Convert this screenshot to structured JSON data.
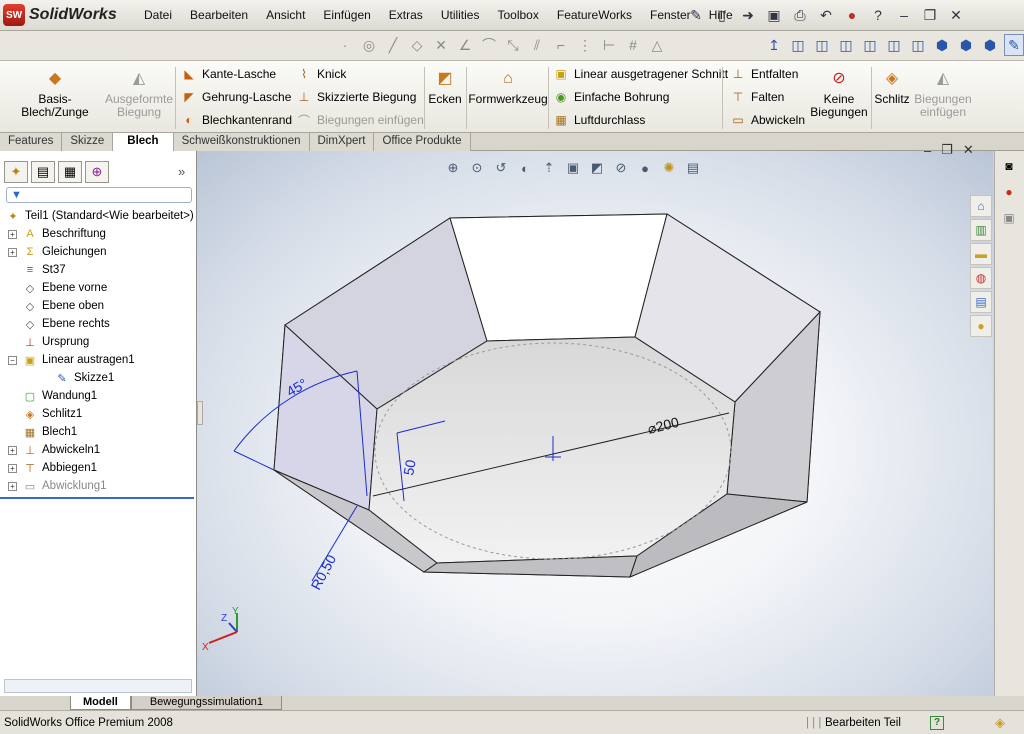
{
  "app": {
    "logo_mark": "SW",
    "logo_text": "SolidWorks"
  },
  "menu": [
    "Datei",
    "Bearbeiten",
    "Ansicht",
    "Einfügen",
    "Extras",
    "Utilities",
    "Toolbox",
    "FeatureWorks",
    "Fenster",
    "Hilfe"
  ],
  "commands": {
    "basis_blech": "Basis-Blech/Zunge",
    "ausgeformte_biegung": "Ausgeformte Biegung",
    "kante_lasche": "Kante-Lasche",
    "gehrung_lasche": "Gehrung-Lasche",
    "blechkantenrand": "Blechkantenrand",
    "knick": "Knick",
    "skizzierte_biegung": "Skizzierte Biegung",
    "biegungen_einfuegen_small": "Biegungen einfügen",
    "ecken": "Ecken",
    "formwerkzeug": "Formwerkzeug",
    "linear_schnitt": "Linear ausgetragener Schnitt",
    "einfache_bohrung": "Einfache Bohrung",
    "luftdurchlass": "Luftdurchlass",
    "entfalten": "Entfalten",
    "falten": "Falten",
    "abwickeln": "Abwickeln",
    "keine_biegungen": "Keine Biegungen",
    "schlitz": "Schlitz",
    "biegungen_einfuegen_big": "Biegungen einfügen"
  },
  "tabs": [
    "Features",
    "Skizze",
    "Blech",
    "Schweißkonstruktionen",
    "DimXpert",
    "Office Produkte"
  ],
  "active_tab": "Blech",
  "tree": {
    "root": "Teil1  (Standard<Wie bearbeitet>)",
    "items": [
      {
        "label": "Beschriftung",
        "icon": "annotation-icon",
        "expand": "+"
      },
      {
        "label": "Gleichungen",
        "icon": "equations-icon",
        "expand": "+"
      },
      {
        "label": "St37",
        "icon": "material-icon",
        "expand": ""
      },
      {
        "label": "Ebene vorne",
        "icon": "plane-icon",
        "expand": ""
      },
      {
        "label": "Ebene oben",
        "icon": "plane-icon",
        "expand": ""
      },
      {
        "label": "Ebene rechts",
        "icon": "plane-icon",
        "expand": ""
      },
      {
        "label": "Ursprung",
        "icon": "origin-icon",
        "expand": ""
      },
      {
        "label": "Linear austragen1",
        "icon": "extrude-icon",
        "expand": "−"
      },
      {
        "label": "Skizze1",
        "icon": "sketch-icon",
        "expand": "",
        "indent": true
      },
      {
        "label": "Wandung1",
        "icon": "shell-icon",
        "expand": ""
      },
      {
        "label": "Schlitz1",
        "icon": "rip-icon",
        "expand": ""
      },
      {
        "label": "Blech1",
        "icon": "sheetmetal-icon",
        "expand": ""
      },
      {
        "label": "Abwickeln1",
        "icon": "unfold-icon",
        "expand": "+"
      },
      {
        "label": "Abbiegen1",
        "icon": "fold-icon",
        "expand": "+"
      },
      {
        "label": "Abwicklung1",
        "icon": "flatpattern-icon",
        "expand": "+",
        "dim": true
      }
    ]
  },
  "bottom_tabs": [
    "Modell",
    "Bewegungssimulation1"
  ],
  "status": {
    "left": "SolidWorks Office Premium 2008",
    "mode": "Bearbeiten Teil",
    "help": "?"
  },
  "dims": {
    "angle": "45°",
    "diameter": "⌀200",
    "height": "50",
    "radius": "R0,50"
  },
  "triad": {
    "x": "X",
    "y": "Y",
    "z": "Z"
  }
}
